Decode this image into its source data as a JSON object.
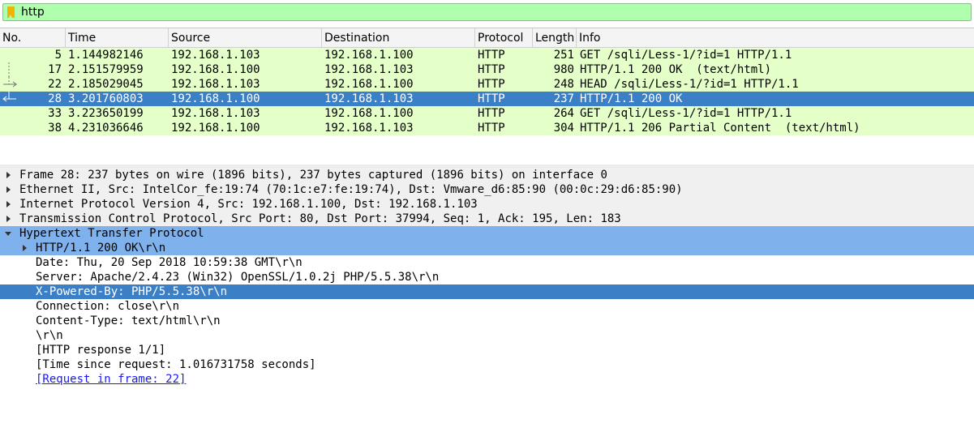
{
  "filter": {
    "value": "http",
    "bookmark_color": "#f0b400",
    "valid_color": "#afffaf"
  },
  "packet_list": {
    "columns": [
      "No.",
      "Time",
      "Source",
      "Destination",
      "Protocol",
      "Length",
      "Info"
    ],
    "rows": [
      {
        "no": "5",
        "time": "1.144982146",
        "src": "192.168.1.103",
        "dst": "192.168.1.100",
        "proto": "HTTP",
        "len": "251",
        "info": "GET /sqli/Less-1/?id=1 HTTP/1.1"
      },
      {
        "no": "17",
        "time": "2.151579959",
        "src": "192.168.1.100",
        "dst": "192.168.1.103",
        "proto": "HTTP",
        "len": "980",
        "info": "HTTP/1.1 200 OK  (text/html)"
      },
      {
        "no": "22",
        "time": "2.185029045",
        "src": "192.168.1.103",
        "dst": "192.168.1.100",
        "proto": "HTTP",
        "len": "248",
        "info": "HEAD /sqli/Less-1/?id=1 HTTP/1.1"
      },
      {
        "no": "28",
        "time": "3.201760803",
        "src": "192.168.1.100",
        "dst": "192.168.1.103",
        "proto": "HTTP",
        "len": "237",
        "info": "HTTP/1.1 200 OK"
      },
      {
        "no": "33",
        "time": "3.223650199",
        "src": "192.168.1.103",
        "dst": "192.168.1.100",
        "proto": "HTTP",
        "len": "264",
        "info": "GET /sqli/Less-1/?id=1 HTTP/1.1"
      },
      {
        "no": "38",
        "time": "4.231036646",
        "src": "192.168.1.100",
        "dst": "192.168.1.103",
        "proto": "HTTP",
        "len": "304",
        "info": "HTTP/1.1 206 Partial Content  (text/html)"
      }
    ],
    "selected_no": "28",
    "row_color": "#e4ffc7",
    "selected_color": "#3b80c6"
  },
  "details": {
    "lines": [
      {
        "text": "Frame 28: 237 bytes on wire (1896 bits), 237 bytes captured (1896 bits) on interface 0",
        "toggle": "collapsed"
      },
      {
        "text": "Ethernet II, Src: IntelCor_fe:19:74 (70:1c:e7:fe:19:74), Dst: Vmware_d6:85:90 (00:0c:29:d6:85:90)",
        "toggle": "collapsed"
      },
      {
        "text": "Internet Protocol Version 4, Src: 192.168.1.100, Dst: 192.168.1.103",
        "toggle": "collapsed"
      },
      {
        "text": "Transmission Control Protocol, Src Port: 80, Dst Port: 37994, Seq: 1, Ack: 195, Len: 183",
        "toggle": "collapsed"
      },
      {
        "text": "Hypertext Transfer Protocol",
        "toggle": "expanded"
      },
      {
        "text": "HTTP/1.1 200 OK\\r\\n",
        "toggle": "collapsed"
      },
      {
        "text": "Date: Thu, 20 Sep 2018 10:59:38 GMT\\r\\n"
      },
      {
        "text": "Server: Apache/2.4.23 (Win32) OpenSSL/1.0.2j PHP/5.5.38\\r\\n"
      },
      {
        "text": "X-Powered-By: PHP/5.5.38\\r\\n"
      },
      {
        "text": "Connection: close\\r\\n"
      },
      {
        "text": "Content-Type: text/html\\r\\n"
      },
      {
        "text": "\\r\\n"
      },
      {
        "text": "[HTTP response 1/1]"
      },
      {
        "text": "[Time since request: 1.016731758 seconds]"
      },
      {
        "text": "[Request in frame: 22]"
      }
    ],
    "highlight_color": "#7fb2ec"
  }
}
